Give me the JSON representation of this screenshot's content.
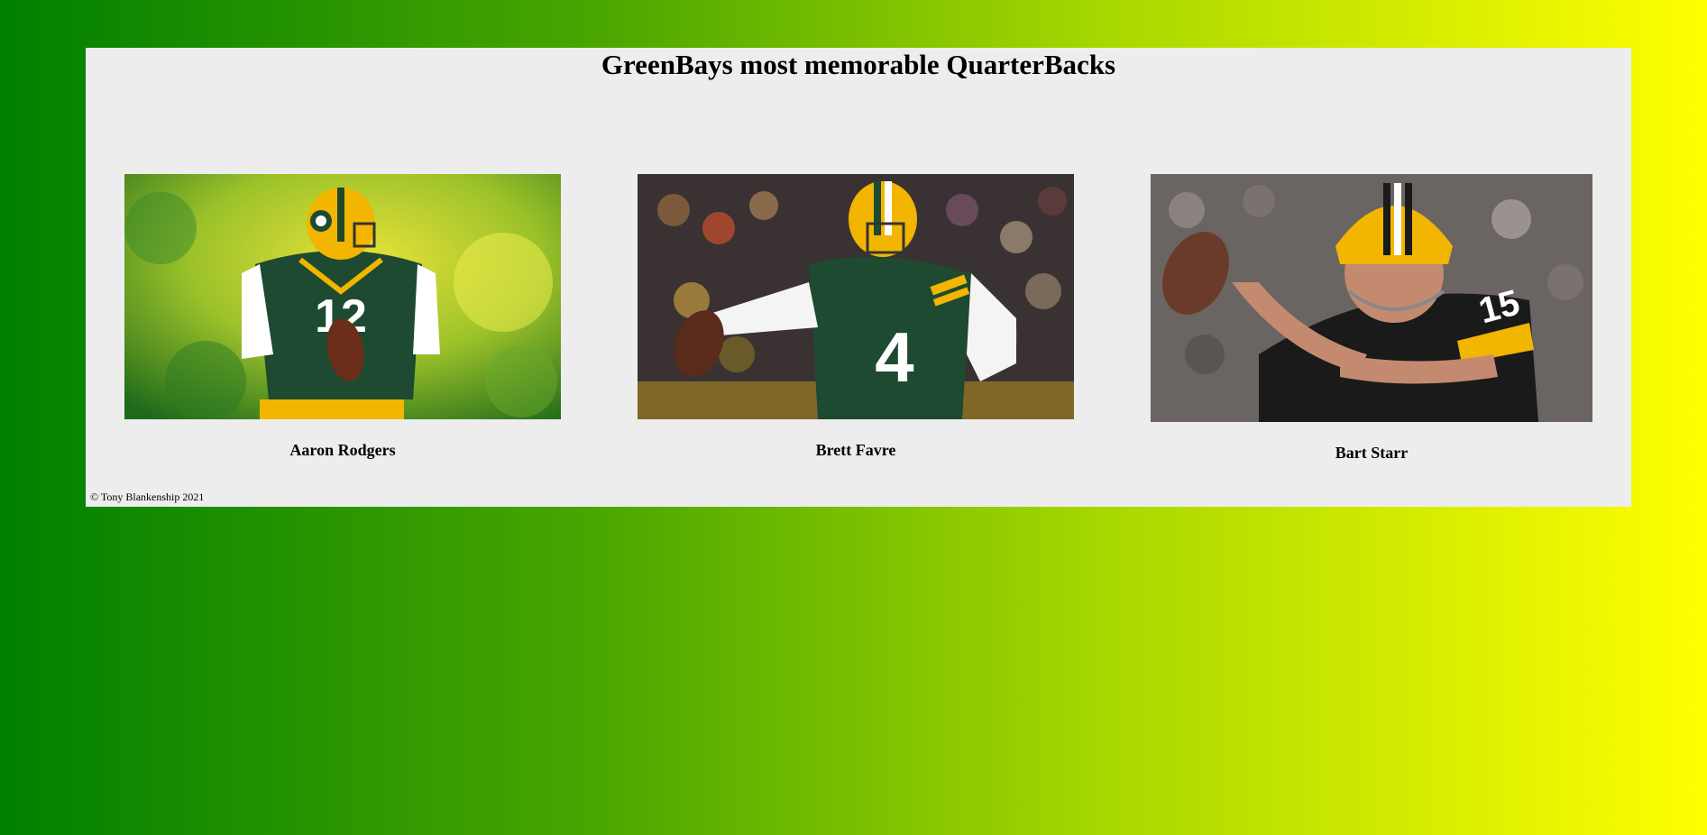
{
  "page": {
    "title": "GreenBays most memorable QuarterBacks",
    "footer": "© Tony Blankenship 2021"
  },
  "players": [
    {
      "name": "Aaron Rodgers",
      "jersey_number": "12"
    },
    {
      "name": "Brett Favre",
      "jersey_number": "4"
    },
    {
      "name": "Bart Starr",
      "jersey_number": "15"
    }
  ],
  "colors": {
    "gradient_start": "#008000",
    "gradient_end": "#ffff00",
    "panel": "#ededed",
    "jersey_green": "#1e4a2e",
    "helmet_gold": "#ffb612"
  }
}
